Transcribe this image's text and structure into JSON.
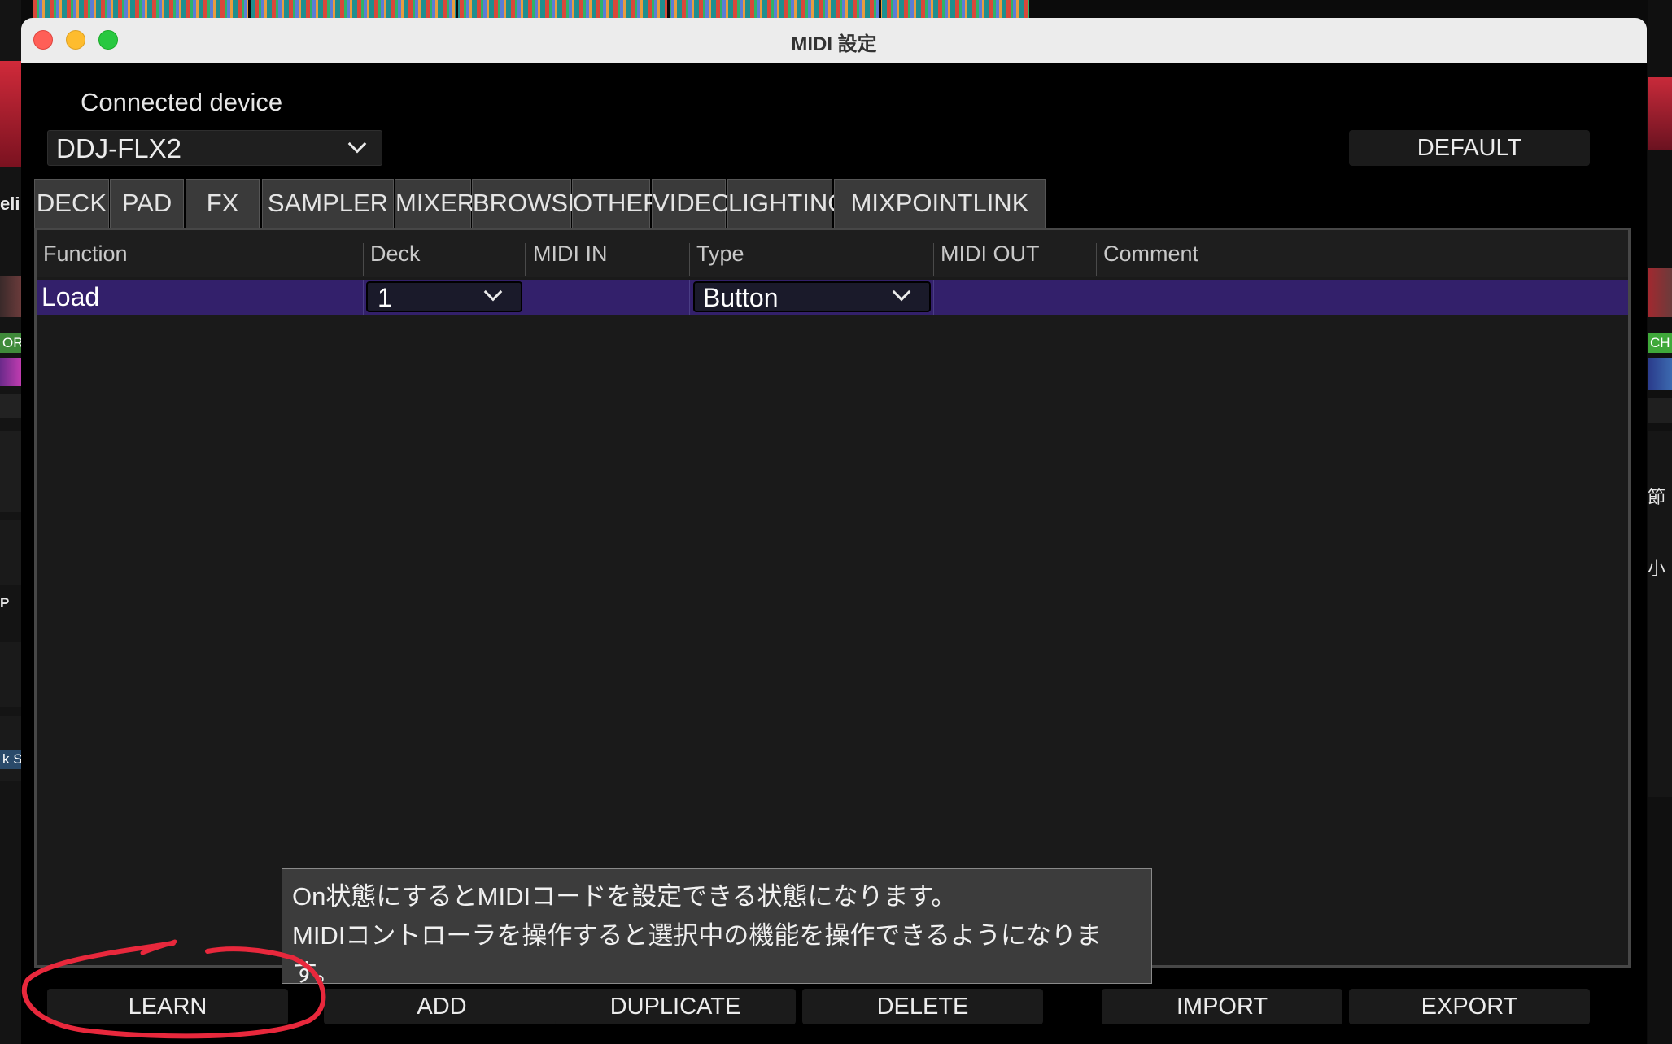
{
  "window": {
    "title": "MIDI 設定"
  },
  "device": {
    "label": "Connected device",
    "selected": "DDJ-FLX2",
    "default_label": "DEFAULT"
  },
  "tabs": [
    "DECK",
    "PAD",
    "FX",
    "SAMPLER",
    "MIXER",
    "BROWSE",
    "OTHER",
    "VIDEO",
    "LIGHTING",
    "MIXPOINTLINK"
  ],
  "table": {
    "columns": [
      "Function",
      "Deck",
      "MIDI IN",
      "Type",
      "MIDI OUT",
      "Comment"
    ],
    "rows": [
      {
        "function": "Load",
        "deck": "1",
        "midi_in": "",
        "type": "Button",
        "midi_out": "",
        "comment": ""
      }
    ]
  },
  "tooltip": {
    "line1": "On状態にするとMIDIコードを設定できる状態になります。",
    "line2": "MIDIコントローラを操作すると選択中の機能を操作できるようになりま",
    "line3": "す。"
  },
  "buttons": {
    "learn": "LEARN",
    "add": "ADD",
    "duplicate": "DUPLICATE",
    "delete": "DELETE",
    "import": "IMPORT",
    "export": "EXPORT"
  },
  "background": {
    "left_labels": [
      "eli",
      "OR",
      "P",
      "k S"
    ],
    "right_labels": [
      "CH",
      "節",
      "小"
    ]
  },
  "colors": {
    "selected_row": "#33206b",
    "annotation": "#e8283c",
    "tooltip_bg": "#3c3c3c"
  }
}
